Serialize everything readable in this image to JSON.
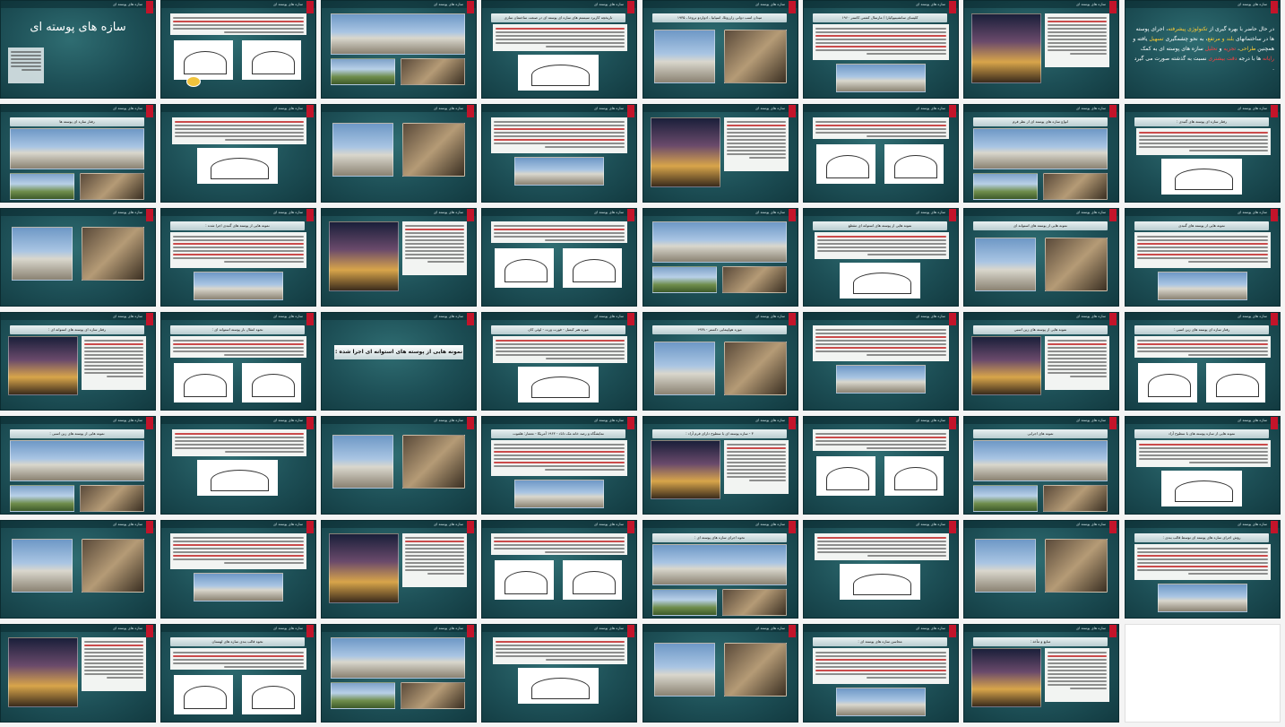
{
  "deck_title": "سازه های پوسته ای",
  "header_text": "سازه های پوسته ای",
  "intro_slide": {
    "segments": [
      {
        "text": "در حال حاضر با بهره گیری از ",
        "style": "plain"
      },
      {
        "text": "تکنولوژی پیشرفته",
        "style": "hl"
      },
      {
        "text": "، اجرای پوسته ها در ساختمانهای ",
        "style": "plain"
      },
      {
        "text": "بلند و مرتفع",
        "style": "hl"
      },
      {
        "text": "، به نحو چشمگیری ",
        "style": "plain"
      },
      {
        "text": "تسهیل",
        "style": "hl"
      },
      {
        "text": " یافته و همچنین ",
        "style": "plain"
      },
      {
        "text": "طراحی",
        "style": "hl"
      },
      {
        "text": "، ",
        "style": "plain"
      },
      {
        "text": "تجزیه",
        "style": "hr"
      },
      {
        "text": " و ",
        "style": "plain"
      },
      {
        "text": "تحلیل",
        "style": "hr"
      },
      {
        "text": " سازه های پوسته ای به کمک ",
        "style": "plain"
      },
      {
        "text": "رایانه",
        "style": "hr"
      },
      {
        "text": " ها با درجه ",
        "style": "plain"
      },
      {
        "text": "دقت بیشتری",
        "style": "hr"
      },
      {
        "text": " نسبت به گذشته صورت می گیرد .",
        "style": "plain"
      }
    ]
  },
  "slide_titles": {
    "r1c4": "تاریخچه کاربرد سیستم های سازه ای پوسته ای در صنعت ساختمان سازی",
    "r1c6": "کلیسای سانشینیوکیارا / مارسال کشتی کاستر ۱۹۶۰",
    "r1c5": "میدان اسب دوانی زارزوئلا، اسپانیا ، ادواردو تروخا ، ۱۹۳۵",
    "r2c1": "رفتار سازه ای پوسته ها",
    "r2c7": "انواع سازه های پوسته ای از نظر فرم",
    "r2c8": "رفتار سازه ای پوسته های گنبدی :",
    "r3c2": "نمونه هایی از پوسته های گنبدی اجرا شده :",
    "r3c6": "نمونه هایی از پوسته های استوانه ای مقطع",
    "r3c7": "نمونه هایی از پوسته های استوانه ای",
    "r3c8": "نمونه هایی از پوسته های گنبدی",
    "r4c1": "رفتار سازه ای پوسته های استوانه ای :",
    "r4c2": "نحوه انتقال بار پوسته استوانه ای :",
    "r4c3": "نمونه هایی از پوسته های استوانه ای اجرا شده :",
    "r4c4": "موزه هنر کیمبل - فورت ورث - لوئی کان",
    "r4c5": "موزه هواپیمایی دکستر - ۱۹۳۸",
    "r4c7": "نمونه هایی از پوسته های زین اسبی",
    "r4c8": "رفتار سازه ای پوسته های زین اسبی :",
    "r5c1": "نمونه هایی از پوسته های زین اسبی :",
    "r5c4": "نمایشگاه و رصد خانه مک داناد - ۱۹۶۳ آمریکا - معمار: هلموت",
    "r5c5": "۳ - سازه پوسته ای با سطوح دارای فرم آزاد :",
    "r5c7": "نمونه های اجرایی",
    "r5c8": "نمونه هایی از سازه پوسته های با سطوح آزاد",
    "r6c5": "نحوه اجرای سازه های پوسته ای :",
    "r6c8": "روش اجرای سازه های پوسته ای توسط قالب بندی :",
    "r7c2": "نحوه قالب بندی سازه های لهستان",
    "r7c6": "محاسن سازه های پوسته ای :",
    "r7c6b": "معایب سازه های پوسته ای :",
    "r7c7": "منابع و مآخذ :"
  }
}
